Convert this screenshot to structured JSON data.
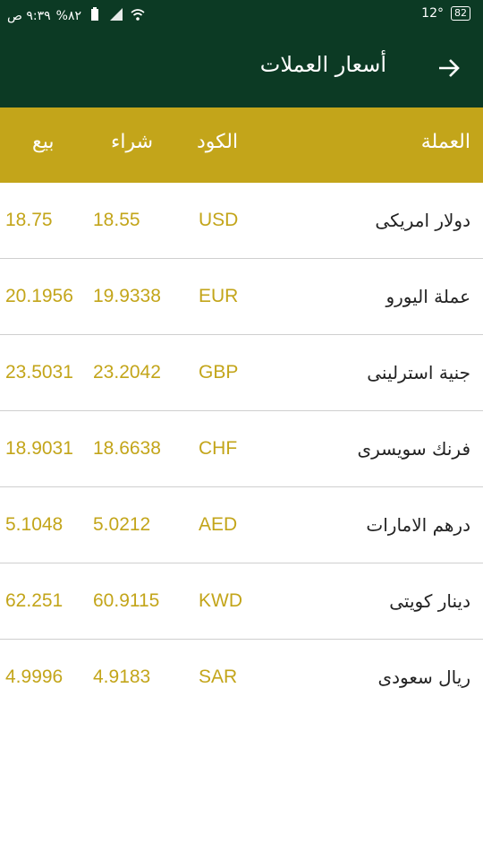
{
  "status_bar": {
    "time": "٩:٣٩ ص",
    "battery_percent": "%٨٢",
    "temperature": "12°",
    "battery_level": "82"
  },
  "app_bar": {
    "title": "أسعار العملات",
    "back_icon": "arrow-right-icon"
  },
  "table": {
    "headers": {
      "currency": "العملة",
      "code": "الكود",
      "buy": "شراء",
      "sell": "بيع"
    },
    "rows": [
      {
        "name": "دولار امريكى",
        "code": "USD",
        "buy": "18.55",
        "sell": "18.75"
      },
      {
        "name": "عملة اليورو",
        "code": "EUR",
        "buy": "19.9338",
        "sell": "20.1956"
      },
      {
        "name": "جنية استرلينى",
        "code": "GBP",
        "buy": "23.2042",
        "sell": "23.5031"
      },
      {
        "name": "فرنك سويسرى",
        "code": "CHF",
        "buy": "18.6638",
        "sell": "18.9031"
      },
      {
        "name": "درهم الامارات",
        "code": "AED",
        "buy": "5.0212",
        "sell": "5.1048"
      },
      {
        "name": "دينار كويتى",
        "code": "KWD",
        "buy": "60.9115",
        "sell": "62.251"
      },
      {
        "name": "ريال سعودى",
        "code": "SAR",
        "buy": "4.9183",
        "sell": "4.9996"
      }
    ]
  },
  "colors": {
    "primary": "#0c3a24",
    "accent": "#c3a51a",
    "divider": "#cfcfcf"
  }
}
